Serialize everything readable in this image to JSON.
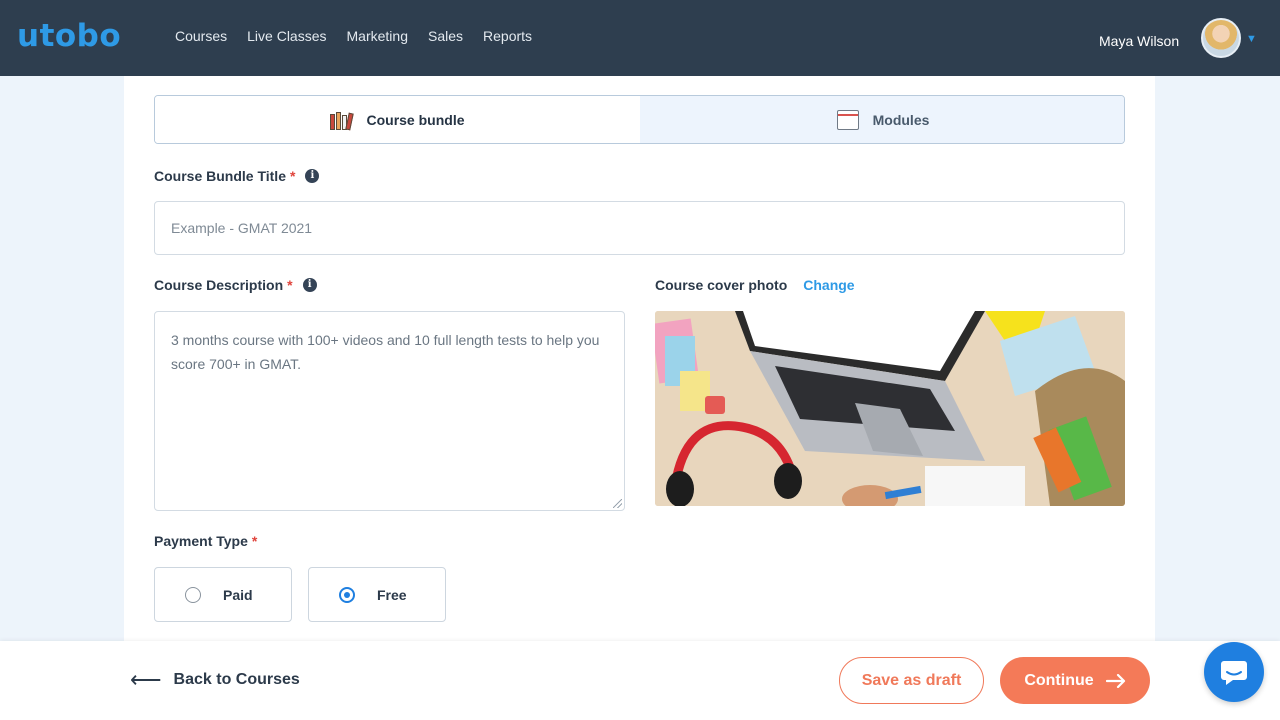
{
  "brand": {
    "logo": "utobo",
    "color": "#2e9ae6"
  },
  "nav": {
    "items": [
      "Courses",
      "Live Classes",
      "Marketing",
      "Sales",
      "Reports"
    ]
  },
  "user": {
    "name": "Maya Wilson"
  },
  "tabs": [
    {
      "label": "Course bundle",
      "icon": "books-icon",
      "active": true
    },
    {
      "label": "Modules",
      "icon": "folder-icon",
      "active": false
    }
  ],
  "form": {
    "title_label": "Course Bundle Title",
    "title_placeholder": "Example - GMAT 2021",
    "title_value": "",
    "description_label": "Course Description",
    "description_value": "3 months course with 100+ videos and 10 full length tests to help you score 700+ in GMAT.",
    "cover_label": "Course cover photo",
    "cover_change": "Change",
    "payment_label": "Payment Type",
    "payment_options": [
      {
        "label": "Paid",
        "selected": false
      },
      {
        "label": "Free",
        "selected": true
      }
    ],
    "required_mark": "*",
    "info_glyph": "i"
  },
  "footer": {
    "back_label": "Back to Courses",
    "draft_label": "Save as draft",
    "continue_label": "Continue"
  },
  "colors": {
    "accent": "#f47a58",
    "radio": "#1f7fe0",
    "topbar": "#2e3e4f"
  }
}
